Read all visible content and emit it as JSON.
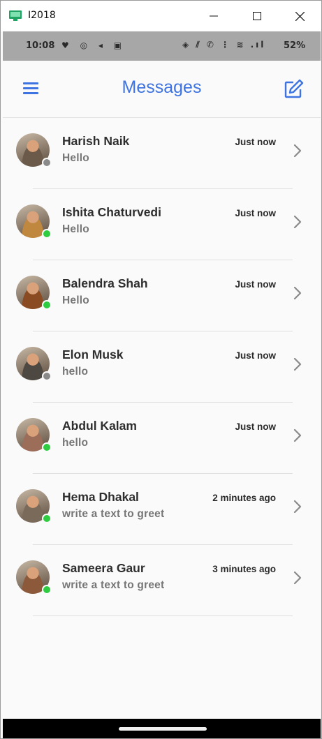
{
  "window": {
    "title": "I2018",
    "controls": {
      "minimize": "minimize-icon",
      "maximize": "maximize-icon",
      "close": "close-icon"
    }
  },
  "statusbar": {
    "time": "10:08",
    "left_icons": "♥ ◎ ◂ ▣",
    "network": "◈ ⫽ ✆ ⋮ ≋ .ıl",
    "battery": "52%"
  },
  "header": {
    "title": "Messages",
    "menu_icon": "hamburger-icon",
    "compose_icon": "compose-icon"
  },
  "colors": {
    "accent": "#3d74e2",
    "online": "#2ecc40",
    "offline": "#8a8a8a"
  },
  "messages": [
    {
      "name": "Harish Naik",
      "preview": "Hello",
      "time": "Just now",
      "status": "offline",
      "avatar_color": "#6b5a4a"
    },
    {
      "name": "Ishita Chaturvedi",
      "preview": "Hello",
      "time": "Just now",
      "status": "online",
      "avatar_color": "#c0873f"
    },
    {
      "name": "Balendra Shah",
      "preview": "Hello",
      "time": "Just now",
      "status": "online",
      "avatar_color": "#8a4a22"
    },
    {
      "name": "Elon Musk",
      "preview": "hello",
      "time": "Just now",
      "status": "offline",
      "avatar_color": "#4e4842"
    },
    {
      "name": "Abdul Kalam",
      "preview": "hello",
      "time": "Just now",
      "status": "online",
      "avatar_color": "#9c6e5a"
    },
    {
      "name": "Hema Dhakal",
      "preview": "write a text to greet",
      "time": "2 minutes ago",
      "status": "online",
      "avatar_color": "#7a6a5a"
    },
    {
      "name": "Sameera Gaur",
      "preview": "write a text to greet",
      "time": "3 minutes ago",
      "status": "online",
      "avatar_color": "#8c5a3a"
    }
  ]
}
